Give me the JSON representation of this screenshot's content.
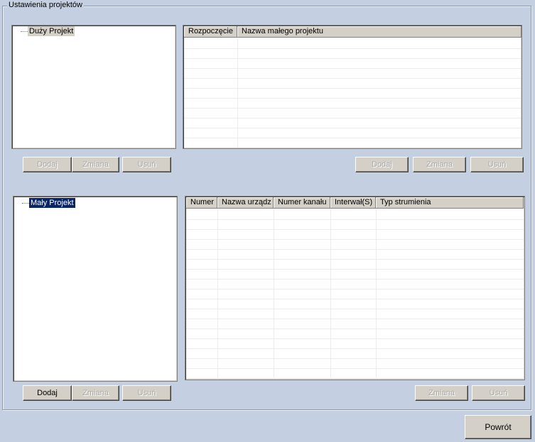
{
  "group": {
    "title": "Ustawienia projektów"
  },
  "big_tree": {
    "root_label": "Duży Projekt"
  },
  "big_list": {
    "columns": [
      "Rozpoczęcie",
      "Nazwa małego projektu"
    ],
    "rows": []
  },
  "big_buttons_left": {
    "add": "Dodaj",
    "edit": "Zmiana",
    "delete": "Usuń"
  },
  "big_buttons_right": {
    "add": "Dodaj",
    "edit": "Zmiana",
    "delete": "Usuń"
  },
  "small_tree": {
    "root_label": "Mały Projekt"
  },
  "small_list": {
    "columns": [
      "Numer",
      "Nazwa urządz",
      "Numer kanału",
      "Interwał(S)",
      "Typ strumienia"
    ],
    "rows": []
  },
  "small_buttons_left": {
    "add": "Dodaj",
    "edit": "Zmiana",
    "delete": "Usuń"
  },
  "small_buttons_right": {
    "edit": "Zmiana",
    "delete": "Usuń"
  },
  "footer": {
    "back": "Powrót"
  }
}
